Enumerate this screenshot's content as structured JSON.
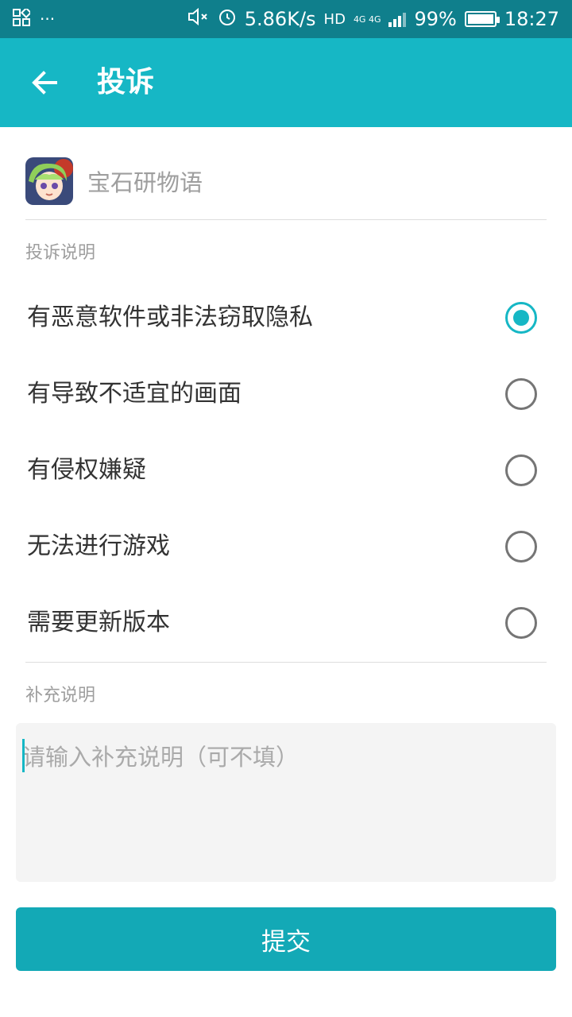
{
  "status_bar": {
    "network_speed": "5.86K/s",
    "hd": "HD",
    "network_type": "4G 4G",
    "battery": "99%",
    "battery_level": 0.99,
    "time": "18:27",
    "more": "···"
  },
  "header": {
    "title": "投诉",
    "back_icon": "arrow-left-icon"
  },
  "app": {
    "name": "宝石研物语"
  },
  "complaint_section": {
    "label": "投诉说明",
    "options": [
      {
        "label": "有恶意软件或非法窃取隐私",
        "checked": true
      },
      {
        "label": "有导致不适宜的画面",
        "checked": false
      },
      {
        "label": "有侵权嫌疑",
        "checked": false
      },
      {
        "label": "无法进行游戏",
        "checked": false
      },
      {
        "label": "需要更新版本",
        "checked": false
      }
    ]
  },
  "supplement_section": {
    "label": "补充说明",
    "placeholder": "请输入补充说明（可不填）",
    "value": ""
  },
  "submit": {
    "label": "提交"
  },
  "colors": {
    "accent": "#16b7c5",
    "status_bar": "#0f7f8c",
    "button": "#13a9b6"
  }
}
